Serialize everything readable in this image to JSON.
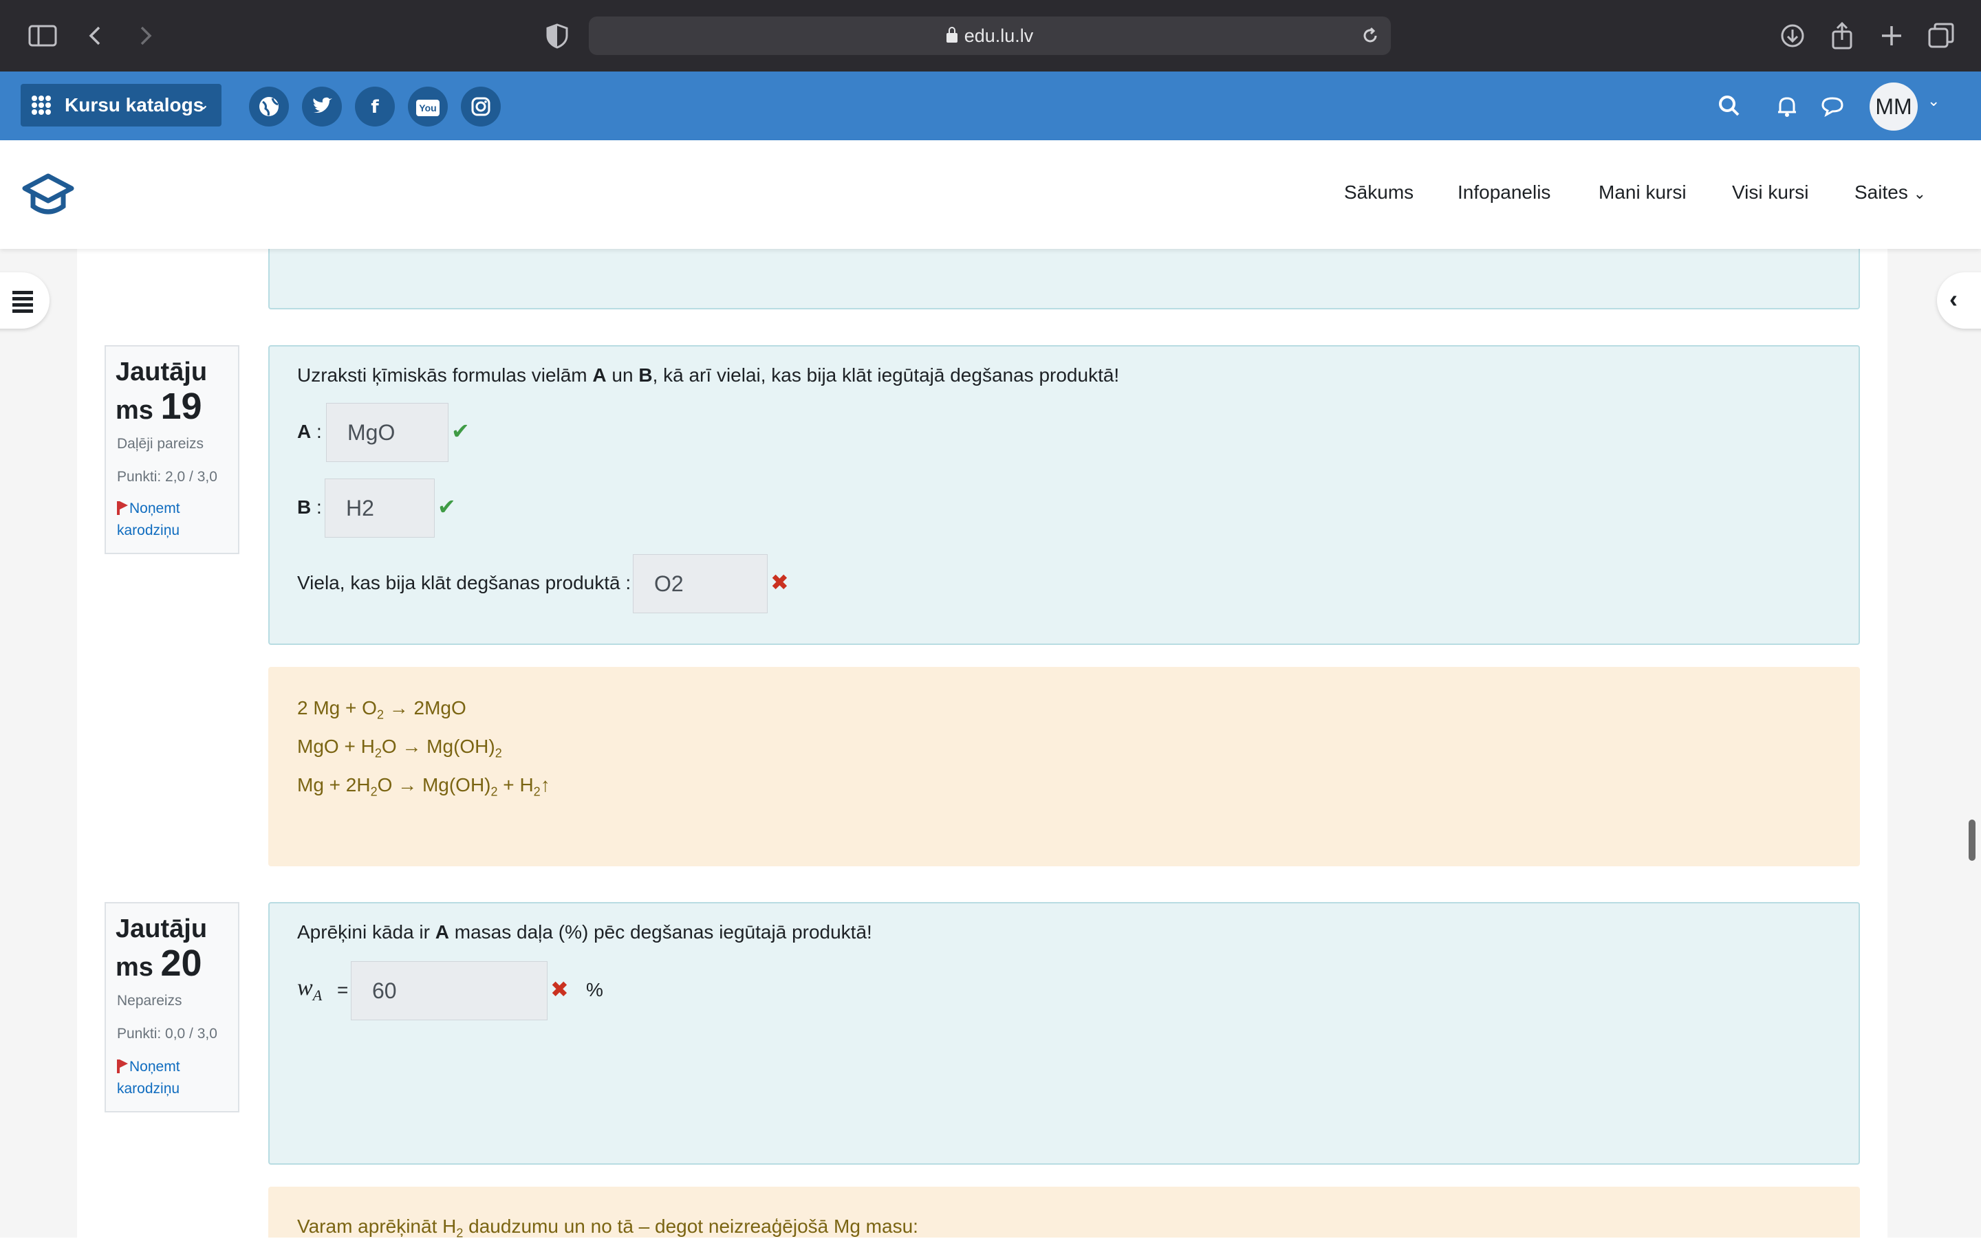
{
  "browser": {
    "url": "edu.lu.lv"
  },
  "navbar": {
    "catalog_label": "Kursu katalogs",
    "social": [
      {
        "icon": "globe-icon",
        "glyph": "🌐"
      },
      {
        "icon": "twitter-icon",
        "glyph": "t"
      },
      {
        "icon": "facebook-icon",
        "glyph": "f"
      },
      {
        "icon": "youtube-icon",
        "glyph": "You"
      },
      {
        "icon": "instagram-icon",
        "glyph": "◎"
      }
    ],
    "avatar_initials": "MM"
  },
  "menu": {
    "items": [
      "Sākums",
      "Infopanelis",
      "Mani kursi",
      "Visi kursi",
      "Saites"
    ]
  },
  "q19": {
    "title_word": "Jautāju",
    "title_word2": "ms",
    "number": "19",
    "status": "Daļēji pareizs",
    "points": "Punkti: 2,0 / 3,0",
    "flag_line1": "Noņemt",
    "flag_line2": "karodziņu",
    "question_pre": "Uzraksti ķīmiskās formulas vielām ",
    "question_a": "A",
    "question_mid": " un ",
    "question_b": "B",
    "question_post": ", kā arī vielai, kas bija klāt iegūtajā degšanas produktā!",
    "label_a": "A",
    "label_b": "B",
    "colon": " :",
    "answer_a": "MgO",
    "answer_b": "H2",
    "label_c": "Viela, kas bija klāt degšanas produktā :",
    "answer_c": "O2",
    "feedback": [
      {
        "parts": [
          "2 Mg + O",
          "2",
          " → 2MgO"
        ]
      },
      {
        "parts": [
          "MgO + H",
          "2",
          "O → Mg(OH)",
          "2",
          ""
        ]
      },
      {
        "parts": [
          "Mg + 2H",
          "2",
          "O → Mg(OH)",
          "2",
          " + H",
          "2",
          "↑"
        ]
      }
    ]
  },
  "q20": {
    "title_word": "Jautāju",
    "title_word2": "ms",
    "number": "20",
    "status": "Nepareizs",
    "points": "Punkti: 0,0 / 3,0",
    "flag_line1": "Noņemt",
    "flag_line2": "karodziņu",
    "question_pre": "Aprēķini kāda ir ",
    "question_a": "A",
    "question_post": " masas daļa (%) pēc degšanas iegūtajā produktā!",
    "w_symbol": "w",
    "w_sub": "A",
    "equals": "=",
    "answer": "60",
    "unit": "%",
    "feedback_pre": "Varam aprēķināt H",
    "feedback_sub": "2",
    "feedback_post": " daudzumu un no tā – degot neizreaģējošā Mg masu:"
  }
}
